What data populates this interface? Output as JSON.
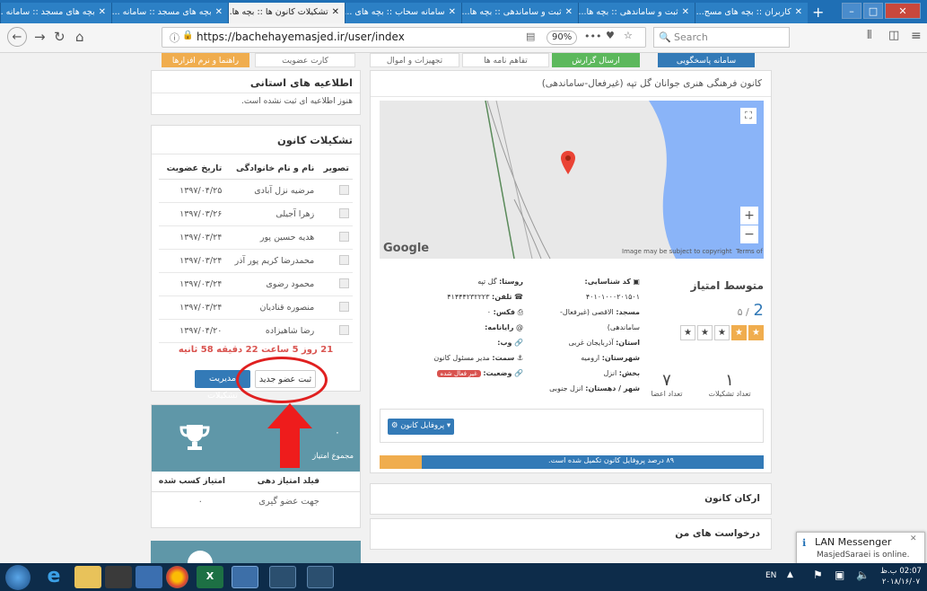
{
  "browser": {
    "tabs": [
      {
        "title": "بچه های مسجد :: سامانه ...",
        "active": false
      },
      {
        "title": "بچه های مسجد :: سامانه ...",
        "active": false
      },
      {
        "title": "تشکیلات کانون ها :: بچه ها...",
        "active": true
      },
      {
        "title": "سامانه سحاب :: بچه های ...",
        "active": false
      },
      {
        "title": "ثبت و ساماندهی :: بچه ها...",
        "active": false
      },
      {
        "title": "ثبت و ساماندهی :: بچه ها...",
        "active": false
      },
      {
        "title": "کاربران :: بچه های مسج...",
        "active": false
      }
    ],
    "new_tab": "+",
    "url": "https://bachehayemasjed.ir/user/index",
    "zoom": "90%",
    "menu_dots": "•••",
    "search_placeholder": "Search"
  },
  "top_buttons": {
    "guide": "راهنما و نرم افزارها",
    "membership_card": "کارت عضویت",
    "equipment": "تجهیزات و اموال",
    "letters": "تفاهم نامه ها",
    "send_report": "ارسال گزارش",
    "response_system": "سامانه پاسخگویی"
  },
  "provincial_news": {
    "title": "اطلاعیه های استانی",
    "empty": "هنوز اطلاعیه ای ثبت نشده است."
  },
  "organization": {
    "title": "تشکیلات کانون",
    "columns": {
      "photo": "تصویر",
      "name": "نام و نام خانوادگی",
      "date": "تاریخ عضویت"
    },
    "rows": [
      {
        "name": "مرضیه نزل آبادی",
        "date": "۱۳۹۷/۰۴/۲۵"
      },
      {
        "name": "زهرا آجیلی",
        "date": "۱۳۹۷/۰۳/۲۶"
      },
      {
        "name": "هدیه حسین پور",
        "date": "۱۳۹۷/۰۳/۲۴"
      },
      {
        "name": "محمدرضا کریم پور آذر",
        "date": "۱۳۹۷/۰۳/۲۴"
      },
      {
        "name": "محمود رضوی",
        "date": "۱۳۹۷/۰۳/۲۴"
      },
      {
        "name": "منصوره قنادیان",
        "date": "۱۳۹۷/۰۳/۲۴"
      },
      {
        "name": "رضا شاهیزاده",
        "date": "۱۳۹۷/۰۴/۲۰"
      }
    ],
    "countdown": "21 روز 5 ساعت 22 دقیقه 58 ثانیه",
    "new_member_button": "ثبت عضو جدید",
    "manage_button": "مدیریت تشکیلات"
  },
  "score_card": {
    "value": "۰",
    "caption": "مجموع امتیاز",
    "col_field": "فیلد امتیاز دهی",
    "col_earned": "امتیاز کسب شده",
    "row_field": "جهت عضو گیری",
    "row_value": "۰"
  },
  "center": {
    "title": "کانون فرهنگی هنری جوانان گل تپه (غیرفعال-ساماندهی)",
    "map": {
      "google": "Google",
      "copyright": "Image may be subject to copyright",
      "terms": "Terms of Use",
      "zoom_in": "+",
      "zoom_out": "−",
      "fullscreen": "⛶"
    },
    "info": {
      "id_label": "کد شناسایی:",
      "id_value": "۴۰۱۰۱۰۰۰۲۰۱۵۰۱",
      "mosque_label": "مسجد:",
      "mosque_value": "الاقصی (غیرفعال-ساماندهی)",
      "province_label": "استان:",
      "province_value": "آذربایجان غربی",
      "county_label": "شهرستان:",
      "county_value": "ارومیه",
      "district_label": "بخش:",
      "district_value": "انزل",
      "city_label": "شهر / دهستان:",
      "city_value": "انزل جنوبی",
      "village_label": "روستا:",
      "village_value": "گل تپه",
      "phone_label": "تلفن:",
      "phone_value": "۴۱۴۴۴۲۳۲۲۲۳",
      "fax_label": "فکس:",
      "fax_value": "۰",
      "email_label": "رایانامه:",
      "email_value": "",
      "web_label": "وب:",
      "web_value": "",
      "role_label": "سمت:",
      "role_value": "مدیر مسئول کانون",
      "status_label": "وضعیت:",
      "status_value": "غیر فعال شده"
    },
    "rating": {
      "title": "متوسط امتیاز",
      "value": "2",
      "max": "/ ۵",
      "stars": 2
    },
    "stats": {
      "orgs_count": "۱",
      "orgs_label": "تعداد تشکیلات",
      "members_count": "۷",
      "members_label": "تعداد اعضا"
    },
    "profile_button": "پروفایل کانون",
    "progress_text": "۸۹ درصد پروفایل کانون تکمیل شده است.",
    "progress": 0.89,
    "section1": "ارکان کانون",
    "section2": "درخواست های من"
  },
  "notification": {
    "title": "LAN Messenger",
    "text": "MasjedSaraei is online."
  },
  "taskbar": {
    "lang": "EN",
    "time": "02:07 ب.ظ",
    "date": "۲۰۱۸/۱۶/۰۷"
  },
  "colors": {
    "accent": "#337ab7",
    "warning": "#f0ad4e",
    "danger": "#d9534f",
    "teal": "#5f97a8"
  }
}
